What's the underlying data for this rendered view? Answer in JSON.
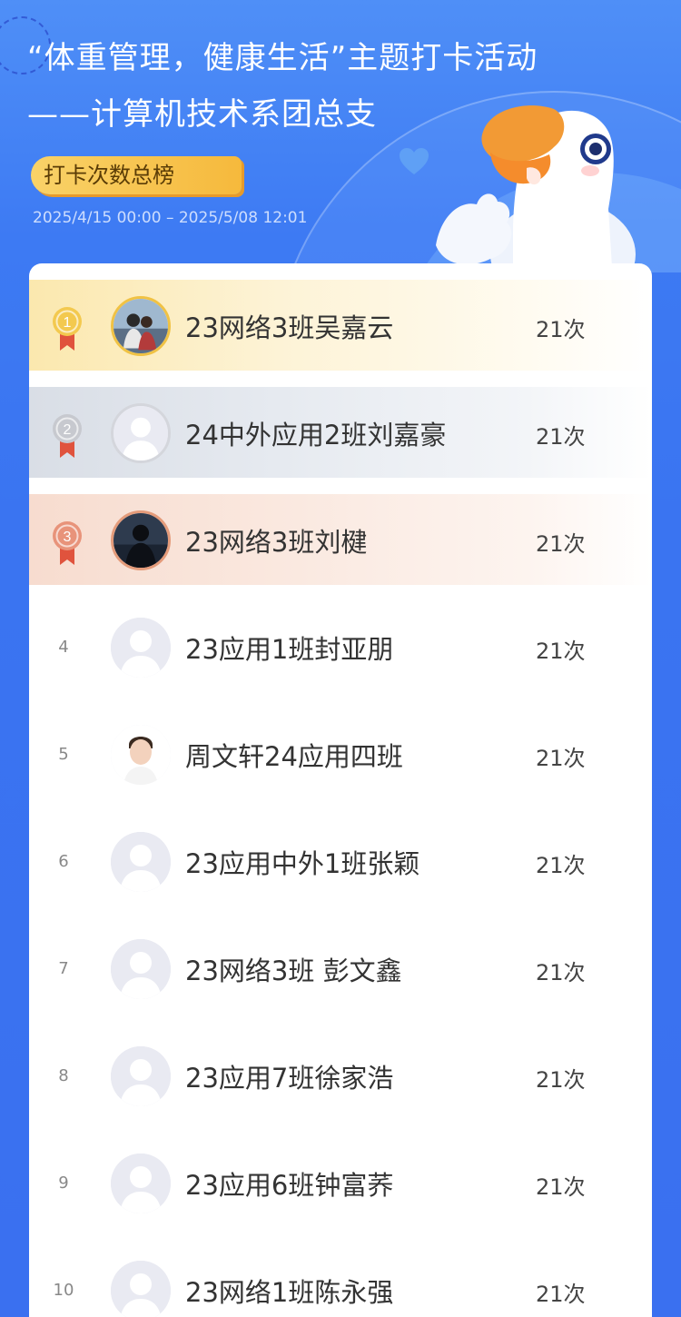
{
  "header": {
    "title_line1": "“体重管理，健康生活”主题打卡活动",
    "title_line2": "——计算机技术系团总支",
    "tag_label": "打卡次数总榜",
    "date_range": "2025/4/15 00:00 – 2025/5/08 12:01"
  },
  "leaderboard": [
    {
      "rank": "1",
      "name": "23网络3班吴嘉云",
      "count": "21次",
      "medal": "gold",
      "avatar": "photo-couple"
    },
    {
      "rank": "2",
      "name": "24中外应用2班刘嘉豪",
      "count": "21次",
      "medal": "silver",
      "avatar": "default"
    },
    {
      "rank": "3",
      "name": "23网络3班刘楗",
      "count": "21次",
      "medal": "bronze",
      "avatar": "photo-dark"
    },
    {
      "rank": "4",
      "name": "23应用1班封亚朋",
      "count": "21次",
      "avatar": "default"
    },
    {
      "rank": "5",
      "name": "周文轩24应用四班",
      "count": "21次",
      "avatar": "photo-portrait"
    },
    {
      "rank": "6",
      "name": "23应用中外1班张颖",
      "count": "21次",
      "avatar": "default"
    },
    {
      "rank": "7",
      "name": "23网络3班 彭文鑫",
      "count": "21次",
      "avatar": "default"
    },
    {
      "rank": "8",
      "name": "23应用7班徐家浩",
      "count": "21次",
      "avatar": "default"
    },
    {
      "rank": "9",
      "name": "23应用6班钟富荞",
      "count": "21次",
      "avatar": "default"
    },
    {
      "rank": "10",
      "name": "23网络1班陈永强",
      "count": "21次",
      "avatar": "default"
    }
  ],
  "colors": {
    "background": "#3d7af3",
    "tag_gold": "#f6b93c",
    "medal_gold": "#f3c94f",
    "medal_silver": "#c7c9cf",
    "medal_bronze": "#e8937a",
    "ribbon": "#e0533d"
  }
}
